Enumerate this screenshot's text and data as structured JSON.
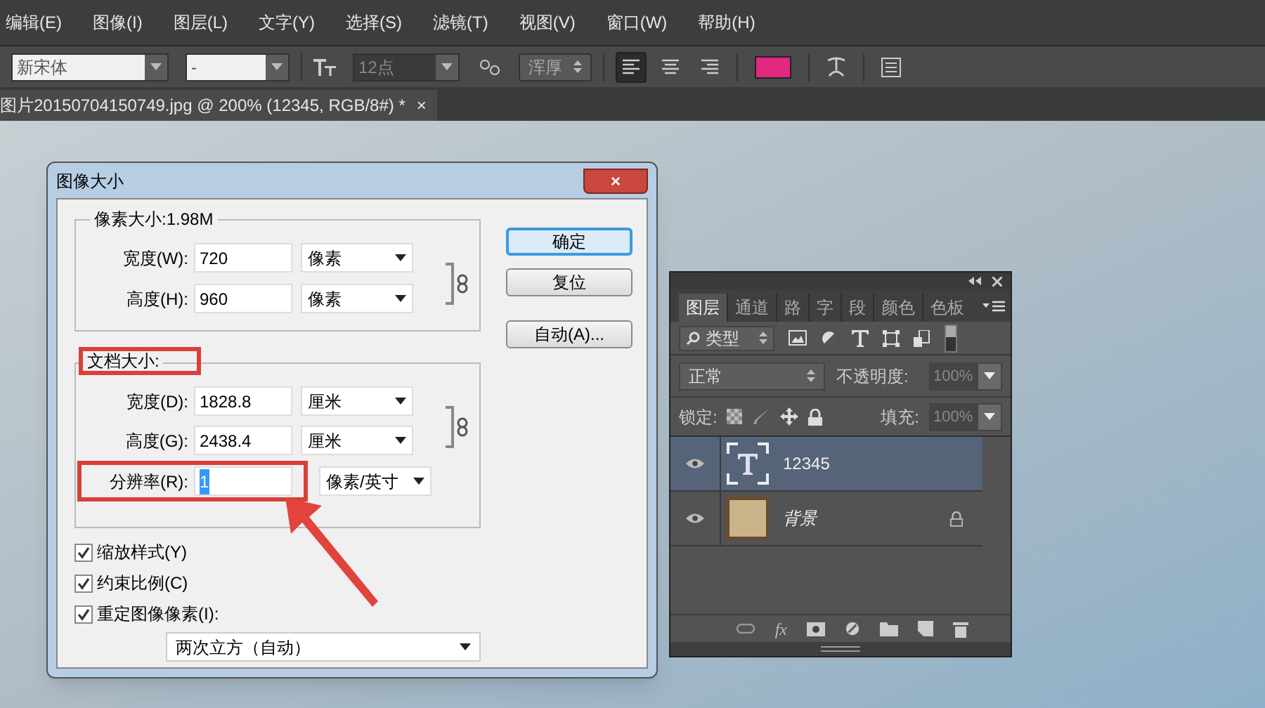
{
  "menu_bar": [
    "编辑(E)",
    "图像(I)",
    "图层(L)",
    "文字(Y)",
    "选择(S)",
    "滤镜(T)",
    "视图(V)",
    "窗口(W)",
    "帮助(H)"
  ],
  "options_bar": {
    "font_family": "新宋体",
    "font_style": "-",
    "font_size": "12点",
    "antialias": "浑厚",
    "alignments": [
      {
        "selected": true
      },
      {
        "selected": false
      },
      {
        "selected": false
      }
    ],
    "text_color": {
      "color": "#e0287f"
    }
  },
  "document_tab": {
    "title": "图片20150704150749.jpg @ 200% (12345, RGB/8#) *",
    "close": "×"
  },
  "image_size_dialog": {
    "title": "图像大小",
    "close": "×",
    "pixel_dimensions": {
      "legend": "像素大小:1.98M",
      "rows": [
        {
          "label": "宽度(W):",
          "value": "720",
          "unit": "像素"
        },
        {
          "label": "高度(H):",
          "value": "960",
          "unit": "像素"
        }
      ]
    },
    "document_size": {
      "legend": "文档大小:",
      "rows": [
        {
          "label": "宽度(D):",
          "value": "1828.8",
          "unit": "厘米",
          "selected": false
        },
        {
          "label": "高度(G):",
          "value": "2438.4",
          "unit": "厘米",
          "selected": false
        },
        {
          "label": "分辨率(R):",
          "value": "1",
          "unit": "像素/英寸",
          "selected": true
        }
      ]
    },
    "checkboxes": [
      {
        "label": "缩放样式(Y)",
        "checked": true
      },
      {
        "label": "约束比例(C)",
        "checked": true
      },
      {
        "label": "重定图像像素(I):",
        "checked": true
      }
    ],
    "resample": "两次立方（自动）",
    "buttons": [
      {
        "label": "确定",
        "default": true
      },
      {
        "label": "复位",
        "default": false
      },
      {
        "label": "自动(A)...",
        "default": false
      }
    ]
  },
  "layers_panel": {
    "tabs": [
      {
        "label": "图层",
        "selected": true
      },
      {
        "label": "通道",
        "selected": false
      },
      {
        "label": "路",
        "selected": false
      },
      {
        "label": "字",
        "selected": false
      },
      {
        "label": "段",
        "selected": false
      },
      {
        "label": "颜色",
        "selected": false
      },
      {
        "label": "色板",
        "selected": false
      }
    ],
    "filter": "类型",
    "blend_mode": "正常",
    "opacity_label": "不透明度:",
    "opacity": "100%",
    "lock_label": "锁定:",
    "fill_label": "填充:",
    "fill": "100%",
    "layers": [
      {
        "name": "12345",
        "kind": "text",
        "selected": true,
        "visible": true,
        "locked": false
      },
      {
        "name": "背景",
        "kind": "image",
        "selected": false,
        "visible": true,
        "locked": true
      }
    ],
    "effects_button": "fx"
  }
}
